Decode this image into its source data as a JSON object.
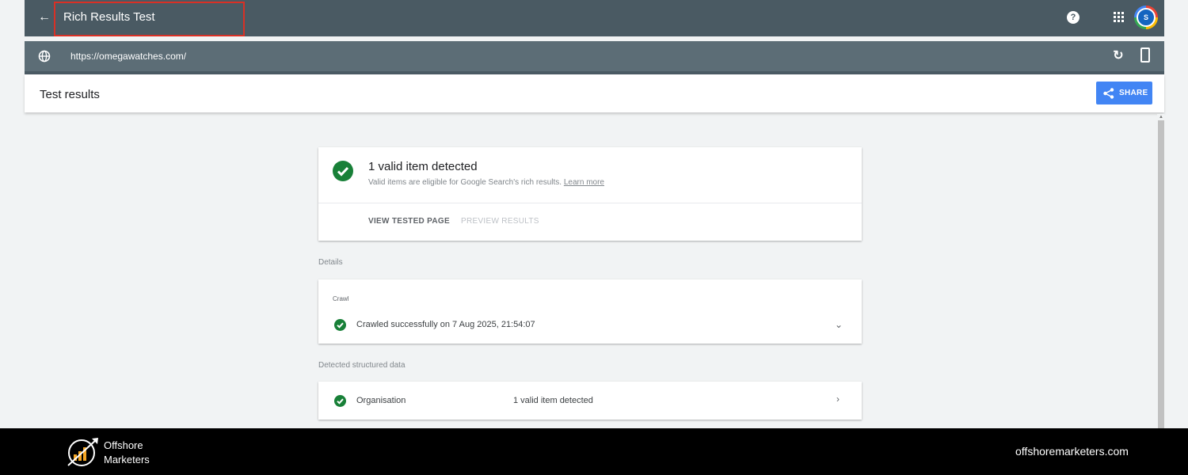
{
  "app": {
    "title": "Rich Results Test",
    "avatar_letter": "S",
    "help_glyph": "?"
  },
  "urlbar": {
    "url": "https://omegawatches.com/"
  },
  "header": {
    "title": "Test results",
    "share_label": "SHARE"
  },
  "summary": {
    "title": "1 valid item detected",
    "subtitle": "Valid items are eligible for Google Search's rich results.",
    "learn_more": "Learn more",
    "tabs": [
      "VIEW TESTED PAGE",
      "PREVIEW RESULTS"
    ]
  },
  "details": {
    "label": "Details",
    "crawl_label": "Crawl",
    "crawl_status": "Crawled successfully on 7 Aug 2025, 21:54:07"
  },
  "structured": {
    "label": "Detected structured data",
    "items": [
      {
        "name": "Organisation",
        "status": "1 valid item detected"
      }
    ]
  },
  "footer": {
    "brand_line1": "Offshore",
    "brand_line2": "Marketers",
    "site": "offshoremarketers.com"
  },
  "colors": {
    "appbar": "#4a5a63",
    "urlbar": "#5c6d76",
    "accent": "#4285f4",
    "success": "#188038",
    "highlight": "#d93025"
  }
}
